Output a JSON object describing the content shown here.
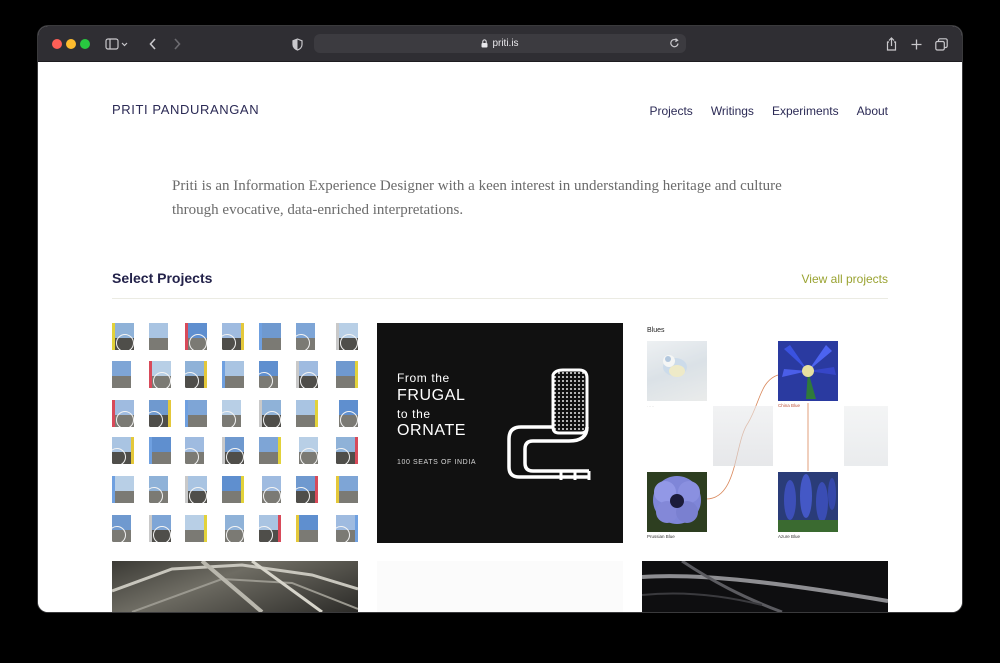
{
  "browser": {
    "url": "priti.is"
  },
  "site": {
    "brand": "PRITI PANDURANGAN",
    "nav": [
      "Projects",
      "Writings",
      "Experiments",
      "About"
    ],
    "intro": "Priti is an Information Experience Designer with a keen interest in understanding heritage and culture through evocative, data-enriched interpretations.",
    "section_title": "Select Projects",
    "view_all": "View all projects"
  },
  "projects": {
    "frugal": {
      "line1": "From the",
      "line2": "FRUGAL",
      "line3": "to the",
      "line4": "ORNATE",
      "subtitle": "100 SEATS OF INDIA"
    },
    "blues": {
      "title": "Blues",
      "labels": [
        "China Blue",
        "Prussian Blue",
        "Azure Blue"
      ]
    }
  },
  "colors": {
    "brand_ink": "#2b2a55",
    "accent_link": "#9aa331",
    "frugal_bg": "#111111",
    "blues_link": "#d07a4a"
  }
}
